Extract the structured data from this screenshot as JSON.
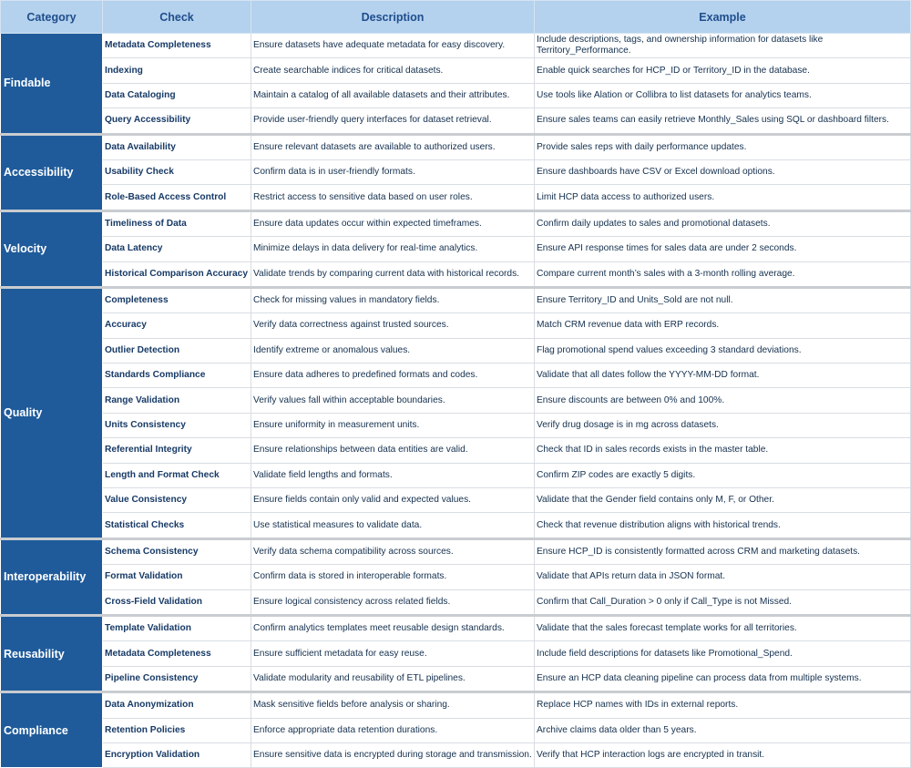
{
  "header": {
    "category": "Category",
    "check": "Check",
    "description": "Description",
    "example": "Example"
  },
  "groups": [
    {
      "category": "Findable",
      "rows": [
        {
          "check": "Metadata Completeness",
          "description": "Ensure datasets have adequate metadata for easy discovery.",
          "example": "Include descriptions, tags, and ownership information for datasets like Territory_Performance."
        },
        {
          "check": "Indexing",
          "description": "Create searchable indices for critical datasets.",
          "example": "Enable quick searches for HCP_ID or Territory_ID in the database."
        },
        {
          "check": "Data Cataloging",
          "description": "Maintain a catalog of all available datasets and their attributes.",
          "example": "Use tools like Alation or Collibra to list datasets for analytics teams."
        },
        {
          "check": "Query Accessibility",
          "description": "Provide user-friendly query interfaces for dataset retrieval.",
          "example": "Ensure sales teams can easily retrieve Monthly_Sales using SQL or dashboard filters."
        }
      ]
    },
    {
      "category": "Accessibility",
      "rows": [
        {
          "check": "Data Availability",
          "description": "Ensure relevant datasets are available to authorized users.",
          "example": "Provide sales reps with daily performance updates."
        },
        {
          "check": "Usability Check",
          "description": "Confirm data is in user-friendly formats.",
          "example": "Ensure dashboards have CSV or Excel download options."
        },
        {
          "check": "Role-Based Access Control",
          "description": "Restrict access to sensitive data based on user roles.",
          "example": "Limit HCP data access to authorized users."
        }
      ]
    },
    {
      "category": "Velocity",
      "rows": [
        {
          "check": "Timeliness of Data",
          "description": "Ensure data updates occur within expected timeframes.",
          "example": "Confirm daily updates to sales and promotional datasets."
        },
        {
          "check": "Data Latency",
          "description": "Minimize delays in data delivery for real-time analytics.",
          "example": "Ensure API response times for sales data are under 2 seconds."
        },
        {
          "check": "Historical Comparison Accuracy",
          "description": "Validate trends by comparing current data with historical records.",
          "example": "Compare current month’s sales with a 3-month rolling average."
        }
      ]
    },
    {
      "category": "Quality",
      "rows": [
        {
          "check": "Completeness",
          "description": "Check for missing values in mandatory fields.",
          "example": "Ensure Territory_ID and Units_Sold are not null."
        },
        {
          "check": "Accuracy",
          "description": "Verify data correctness against trusted sources.",
          "example": "Match CRM revenue data with ERP records."
        },
        {
          "check": "Outlier Detection",
          "description": "Identify extreme or anomalous values.",
          "example": "Flag promotional spend values exceeding 3 standard deviations."
        },
        {
          "check": "Standards Compliance",
          "description": "Ensure data adheres to predefined formats and codes.",
          "example": "Validate that all dates follow the YYYY-MM-DD format."
        },
        {
          "check": "Range Validation",
          "description": "Verify values fall within acceptable boundaries.",
          "example": "Ensure discounts are between 0% and 100%."
        },
        {
          "check": "Units Consistency",
          "description": "Ensure uniformity in measurement units.",
          "example": "Verify drug dosage is in mg across datasets."
        },
        {
          "check": "Referential Integrity",
          "description": "Ensure relationships between data entities are valid.",
          "example": "Check that ID in sales records exists in the master table."
        },
        {
          "check": "Length and Format Check",
          "description": "Validate field lengths and formats.",
          "example": "Confirm ZIP codes are exactly 5 digits."
        },
        {
          "check": "Value Consistency",
          "description": "Ensure fields contain only valid and expected values.",
          "example": "Validate that the Gender field contains only M, F, or Other."
        },
        {
          "check": "Statistical Checks",
          "description": "Use statistical measures to validate data.",
          "example": "Check that revenue distribution aligns with historical trends."
        }
      ]
    },
    {
      "category": "Interoperability",
      "rows": [
        {
          "check": "Schema Consistency",
          "description": "Verify data schema compatibility across sources.",
          "example": "Ensure HCP_ID is consistently formatted across CRM and marketing datasets."
        },
        {
          "check": "Format Validation",
          "description": "Confirm data is stored in interoperable formats.",
          "example": "Validate that APIs return data in JSON format."
        },
        {
          "check": "Cross-Field Validation",
          "description": "Ensure logical consistency across related fields.",
          "example": "Confirm that Call_Duration > 0 only if Call_Type is not Missed."
        }
      ]
    },
    {
      "category": "Reusability",
      "rows": [
        {
          "check": "Template Validation",
          "description": "Confirm analytics templates meet reusable design standards.",
          "example": "Validate that the sales forecast template works for all territories."
        },
        {
          "check": "Metadata Completeness",
          "description": "Ensure sufficient metadata for easy reuse.",
          "example": "Include field descriptions for datasets like Promotional_Spend."
        },
        {
          "check": "Pipeline Consistency",
          "description": "Validate modularity and reusability of ETL pipelines.",
          "example": "Ensure an HCP data cleaning pipeline can process data from multiple systems."
        }
      ]
    },
    {
      "category": "Compliance",
      "rows": [
        {
          "check": "Data Anonymization",
          "description": "Mask sensitive fields before analysis or sharing.",
          "example": "Replace HCP names with IDs in external reports."
        },
        {
          "check": "Retention Policies",
          "description": "Enforce appropriate data retention durations.",
          "example": "Archive claims data older than 5 years."
        },
        {
          "check": "Encryption Validation",
          "description": "Ensure sensitive data is encrypted during storage and transmission.",
          "example": "Verify that HCP interaction logs are encrypted in transit."
        }
      ]
    }
  ]
}
